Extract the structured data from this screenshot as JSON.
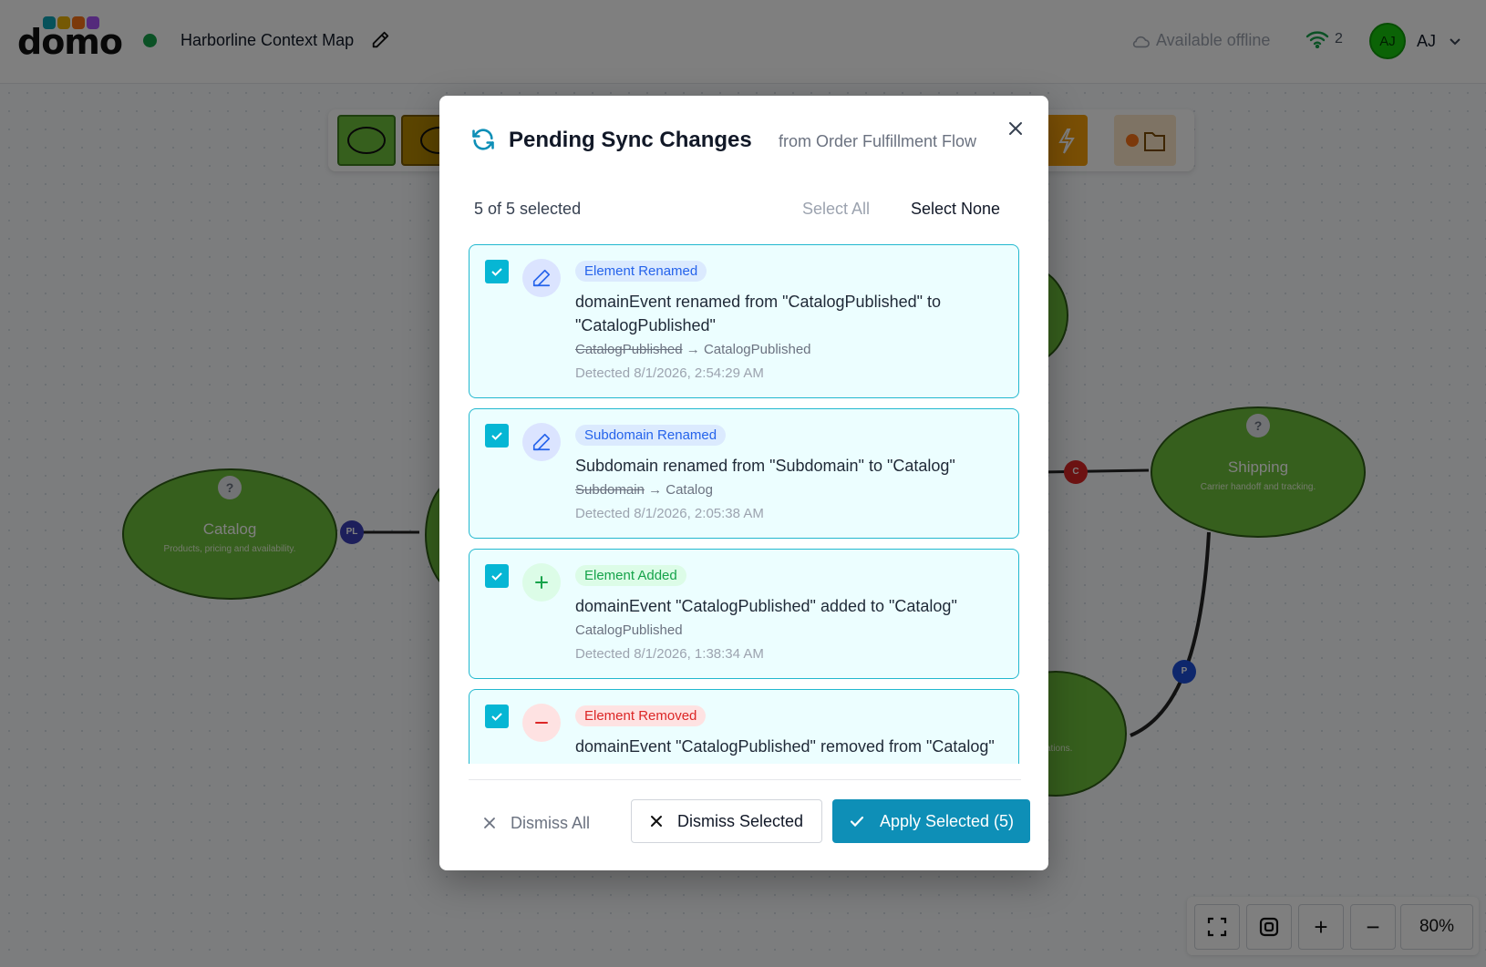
{
  "header": {
    "logo": "domo",
    "map_title": "Harborline Context Map",
    "offline_label": "Available offline",
    "connections_count": "2",
    "user_initials": "AJ",
    "user_name": "AJ"
  },
  "canvas": {
    "nodes": [
      {
        "title": "Catalog",
        "desc": "Products, pricing and availability.",
        "help": "?"
      },
      {
        "title": "Shipping",
        "desc": "Carrier handoff and tracking.",
        "help": "?"
      },
      {
        "partial_desc": "vations."
      }
    ],
    "badges": [
      {
        "label": "PL",
        "color": "#3b3fb6"
      },
      {
        "label": "C",
        "color": "#dc2626"
      },
      {
        "label": "P",
        "color": "#1d4ed8"
      }
    ],
    "zoom_level": "80%"
  },
  "modal": {
    "title": "Pending Sync Changes",
    "subtitle": "from Order Fulfillment Flow",
    "selected_count": "5 of 5 selected",
    "select_all": "Select All",
    "select_none": "Select None",
    "changes": [
      {
        "tag": "Element Renamed",
        "kind": "rename",
        "description": "domainEvent renamed from \"CatalogPublished\" to \"CatalogPublished\"",
        "old": "CatalogPublished",
        "arrow": "→",
        "new": "CatalogPublished",
        "detected": "Detected 8/1/2026, 2:54:29 AM",
        "checked": true
      },
      {
        "tag": "Subdomain Renamed",
        "kind": "rename",
        "description": "Subdomain renamed from \"Subdomain\" to \"Catalog\"",
        "old": "Subdomain",
        "arrow": "→",
        "new": "Catalog",
        "detected": "Detected 8/1/2026, 2:05:38 AM",
        "checked": true
      },
      {
        "tag": "Element Added",
        "kind": "add",
        "description": "domainEvent \"CatalogPublished\" added to \"Catalog\"",
        "value": "CatalogPublished",
        "detected": "Detected 8/1/2026, 1:38:34 AM",
        "checked": true
      },
      {
        "tag": "Element Removed",
        "kind": "remove",
        "description": "domainEvent \"CatalogPublished\" removed from \"Catalog\"",
        "checked": true
      }
    ],
    "dismiss_all": "Dismiss All",
    "dismiss_selected": "Dismiss Selected",
    "apply_selected": "Apply Selected (5)"
  },
  "colors": {
    "accent": "#06b6d4",
    "primary_button": "#0e8fb7",
    "node_fill": "#6dbf3a",
    "rename_tag_bg": "#dbeafe",
    "rename_tag_text": "#2563eb",
    "add_tag_bg": "#dcfce7",
    "add_tag_text": "#16a34a",
    "remove_tag_bg": "#fee2e2",
    "remove_tag_text": "#dc2626"
  }
}
